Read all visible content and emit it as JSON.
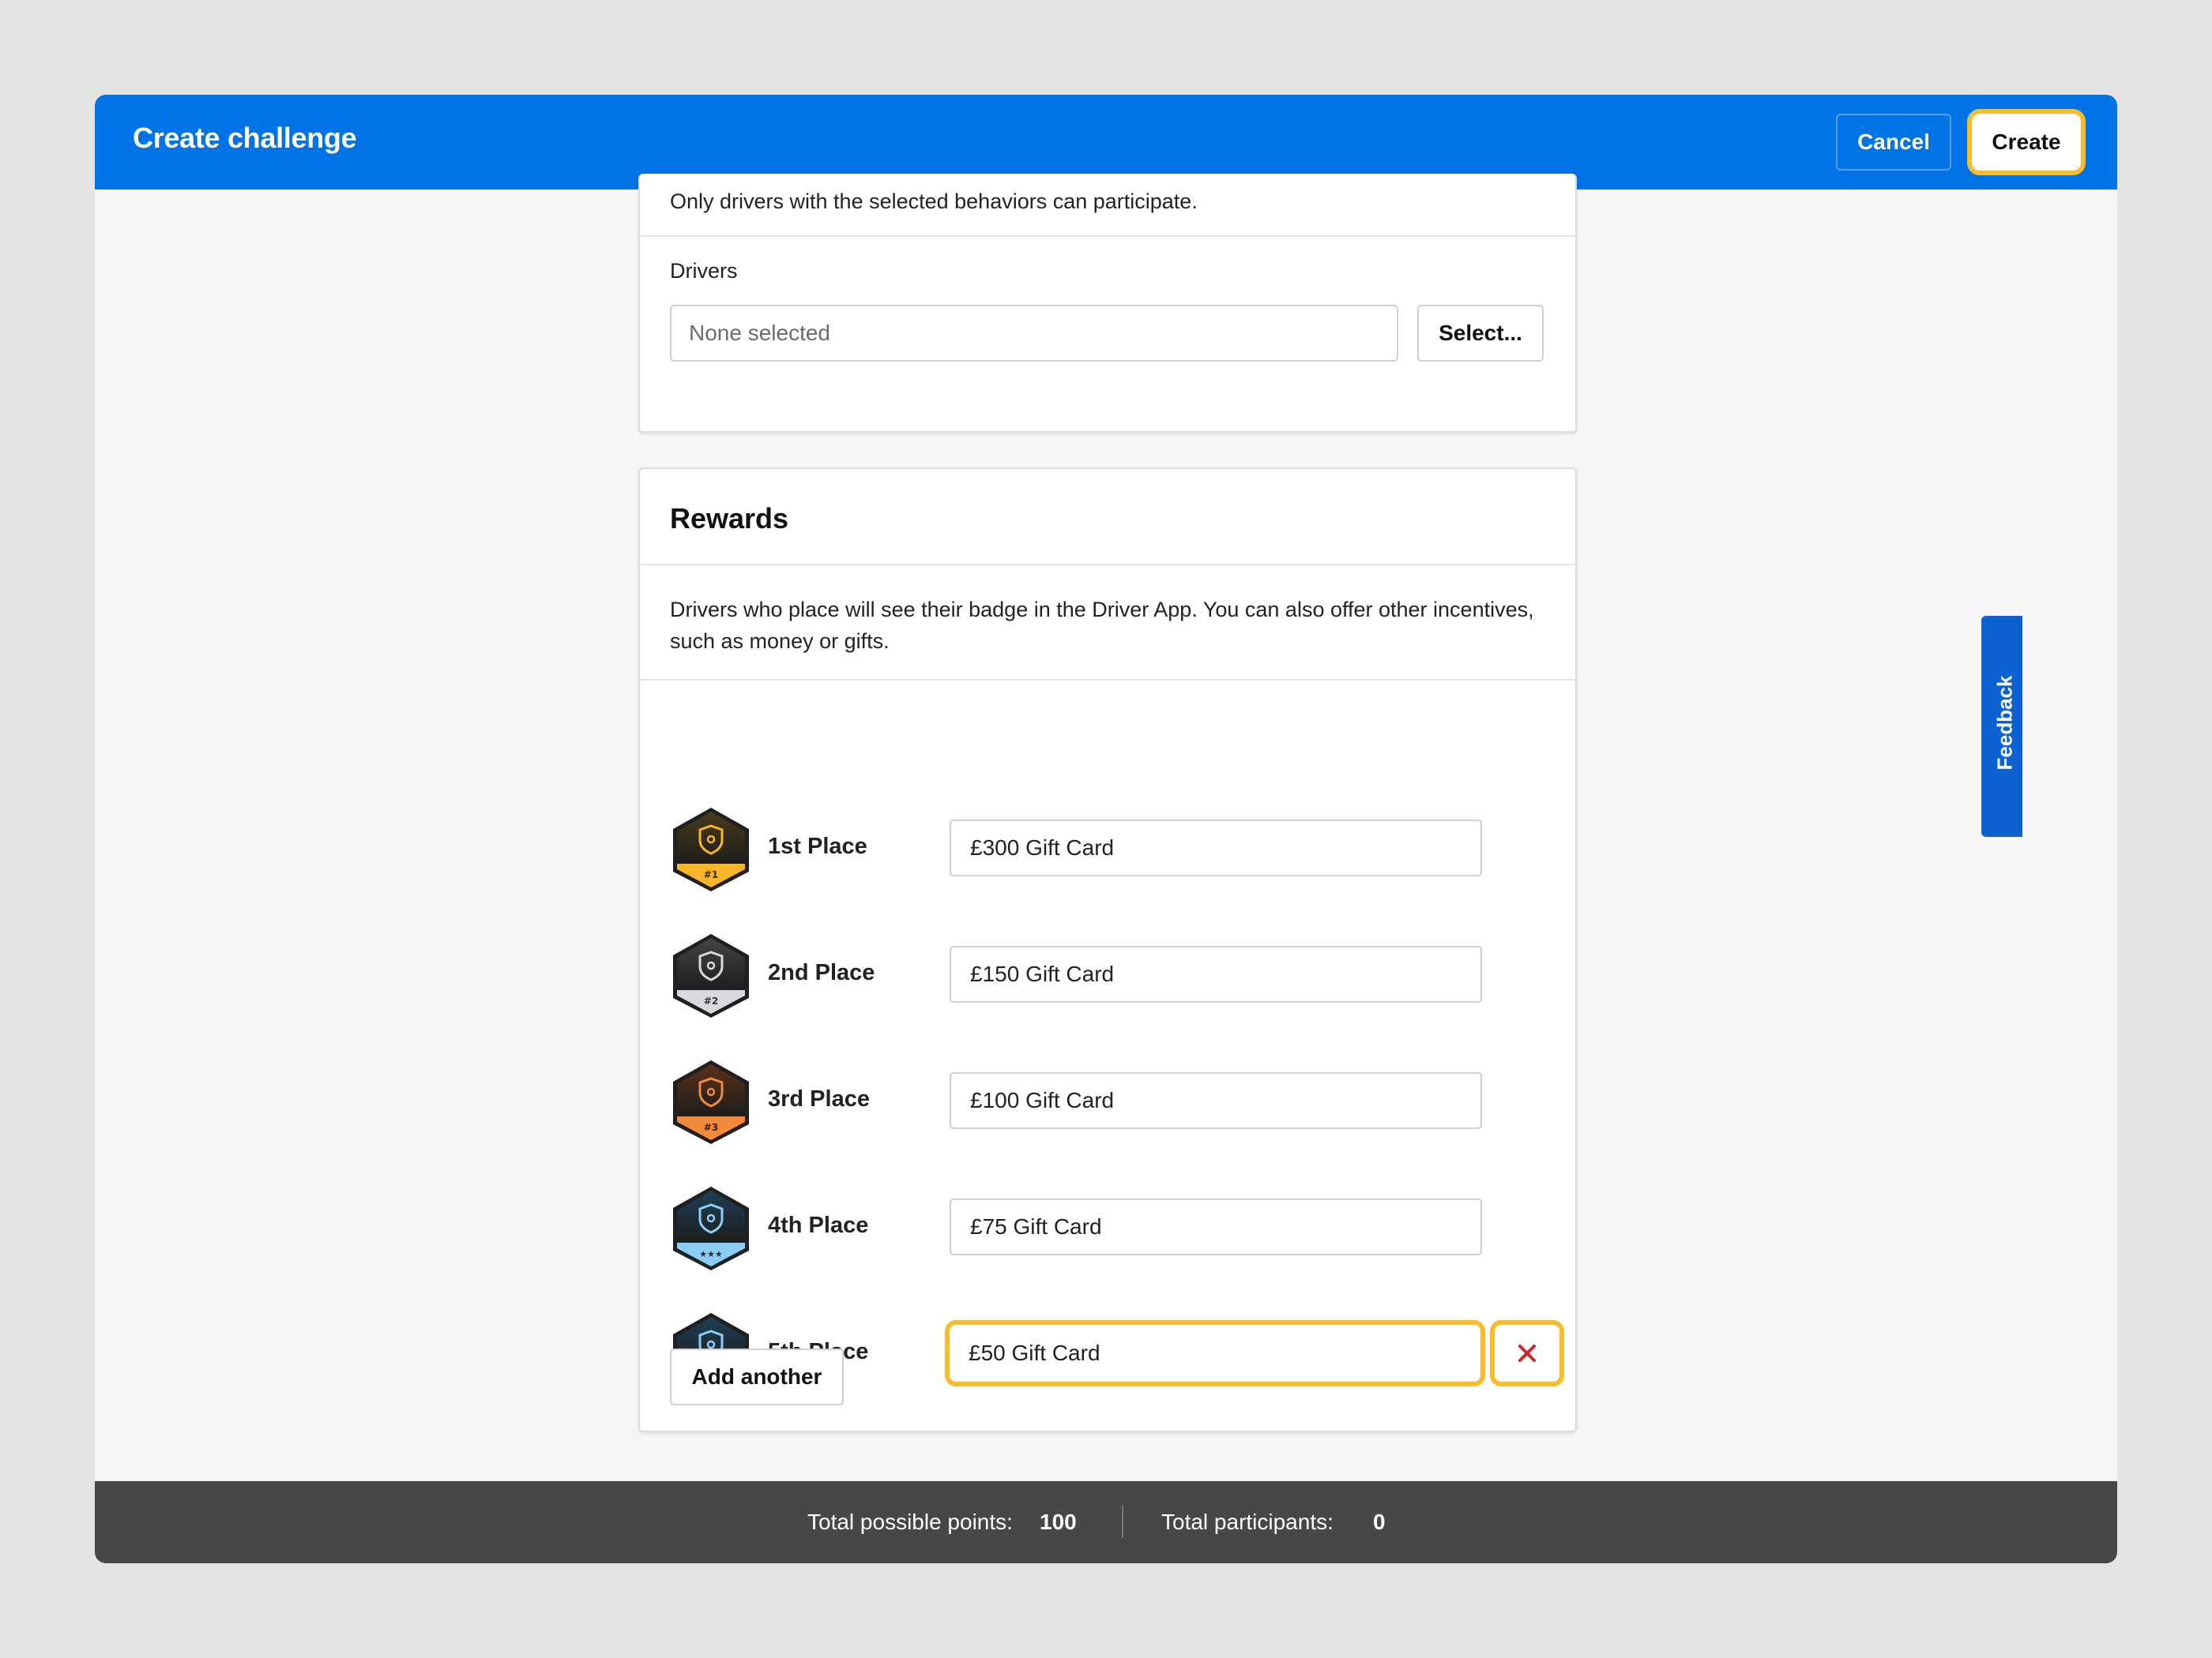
{
  "header": {
    "title": "Create challenge",
    "cancel_label": "Cancel",
    "create_label": "Create"
  },
  "participants": {
    "note": "Only drivers with the selected behaviors can participate.",
    "drivers_label": "Drivers",
    "drivers_value": "None selected",
    "select_label": "Select..."
  },
  "rewards": {
    "title": "Rewards",
    "description": "Drivers who place will see their badge in the Driver App. You can also offer other incentives, such as money or gifts.",
    "rows": [
      {
        "place": "1st Place",
        "value": "£300 Gift Card",
        "badge_text": "#1",
        "badge_color": "#f6b52a"
      },
      {
        "place": "2nd Place",
        "value": "£150 Gift Card",
        "badge_text": "#2",
        "badge_color": "#d7d9dc"
      },
      {
        "place": "3rd Place",
        "value": "£100 Gift Card",
        "badge_text": "#3",
        "badge_color": "#f28a3c"
      },
      {
        "place": "4th Place",
        "value": "£75 Gift Card",
        "badge_text": "★★★",
        "badge_color": "#8ccdf5"
      },
      {
        "place": "5th Place",
        "value": "£50 Gift Card",
        "badge_text": "★★★",
        "badge_color": "#8ccdf5"
      }
    ],
    "add_label": "Add another"
  },
  "footer": {
    "points_label": "Total possible points:",
    "points_value": "100",
    "participants_label": "Total participants:",
    "participants_value": "0"
  },
  "feedback_label": "Feedback",
  "colors": {
    "header": "#0073e6",
    "focus": "#f8bc2c",
    "remove": "#c8262d",
    "footer": "#474747"
  }
}
